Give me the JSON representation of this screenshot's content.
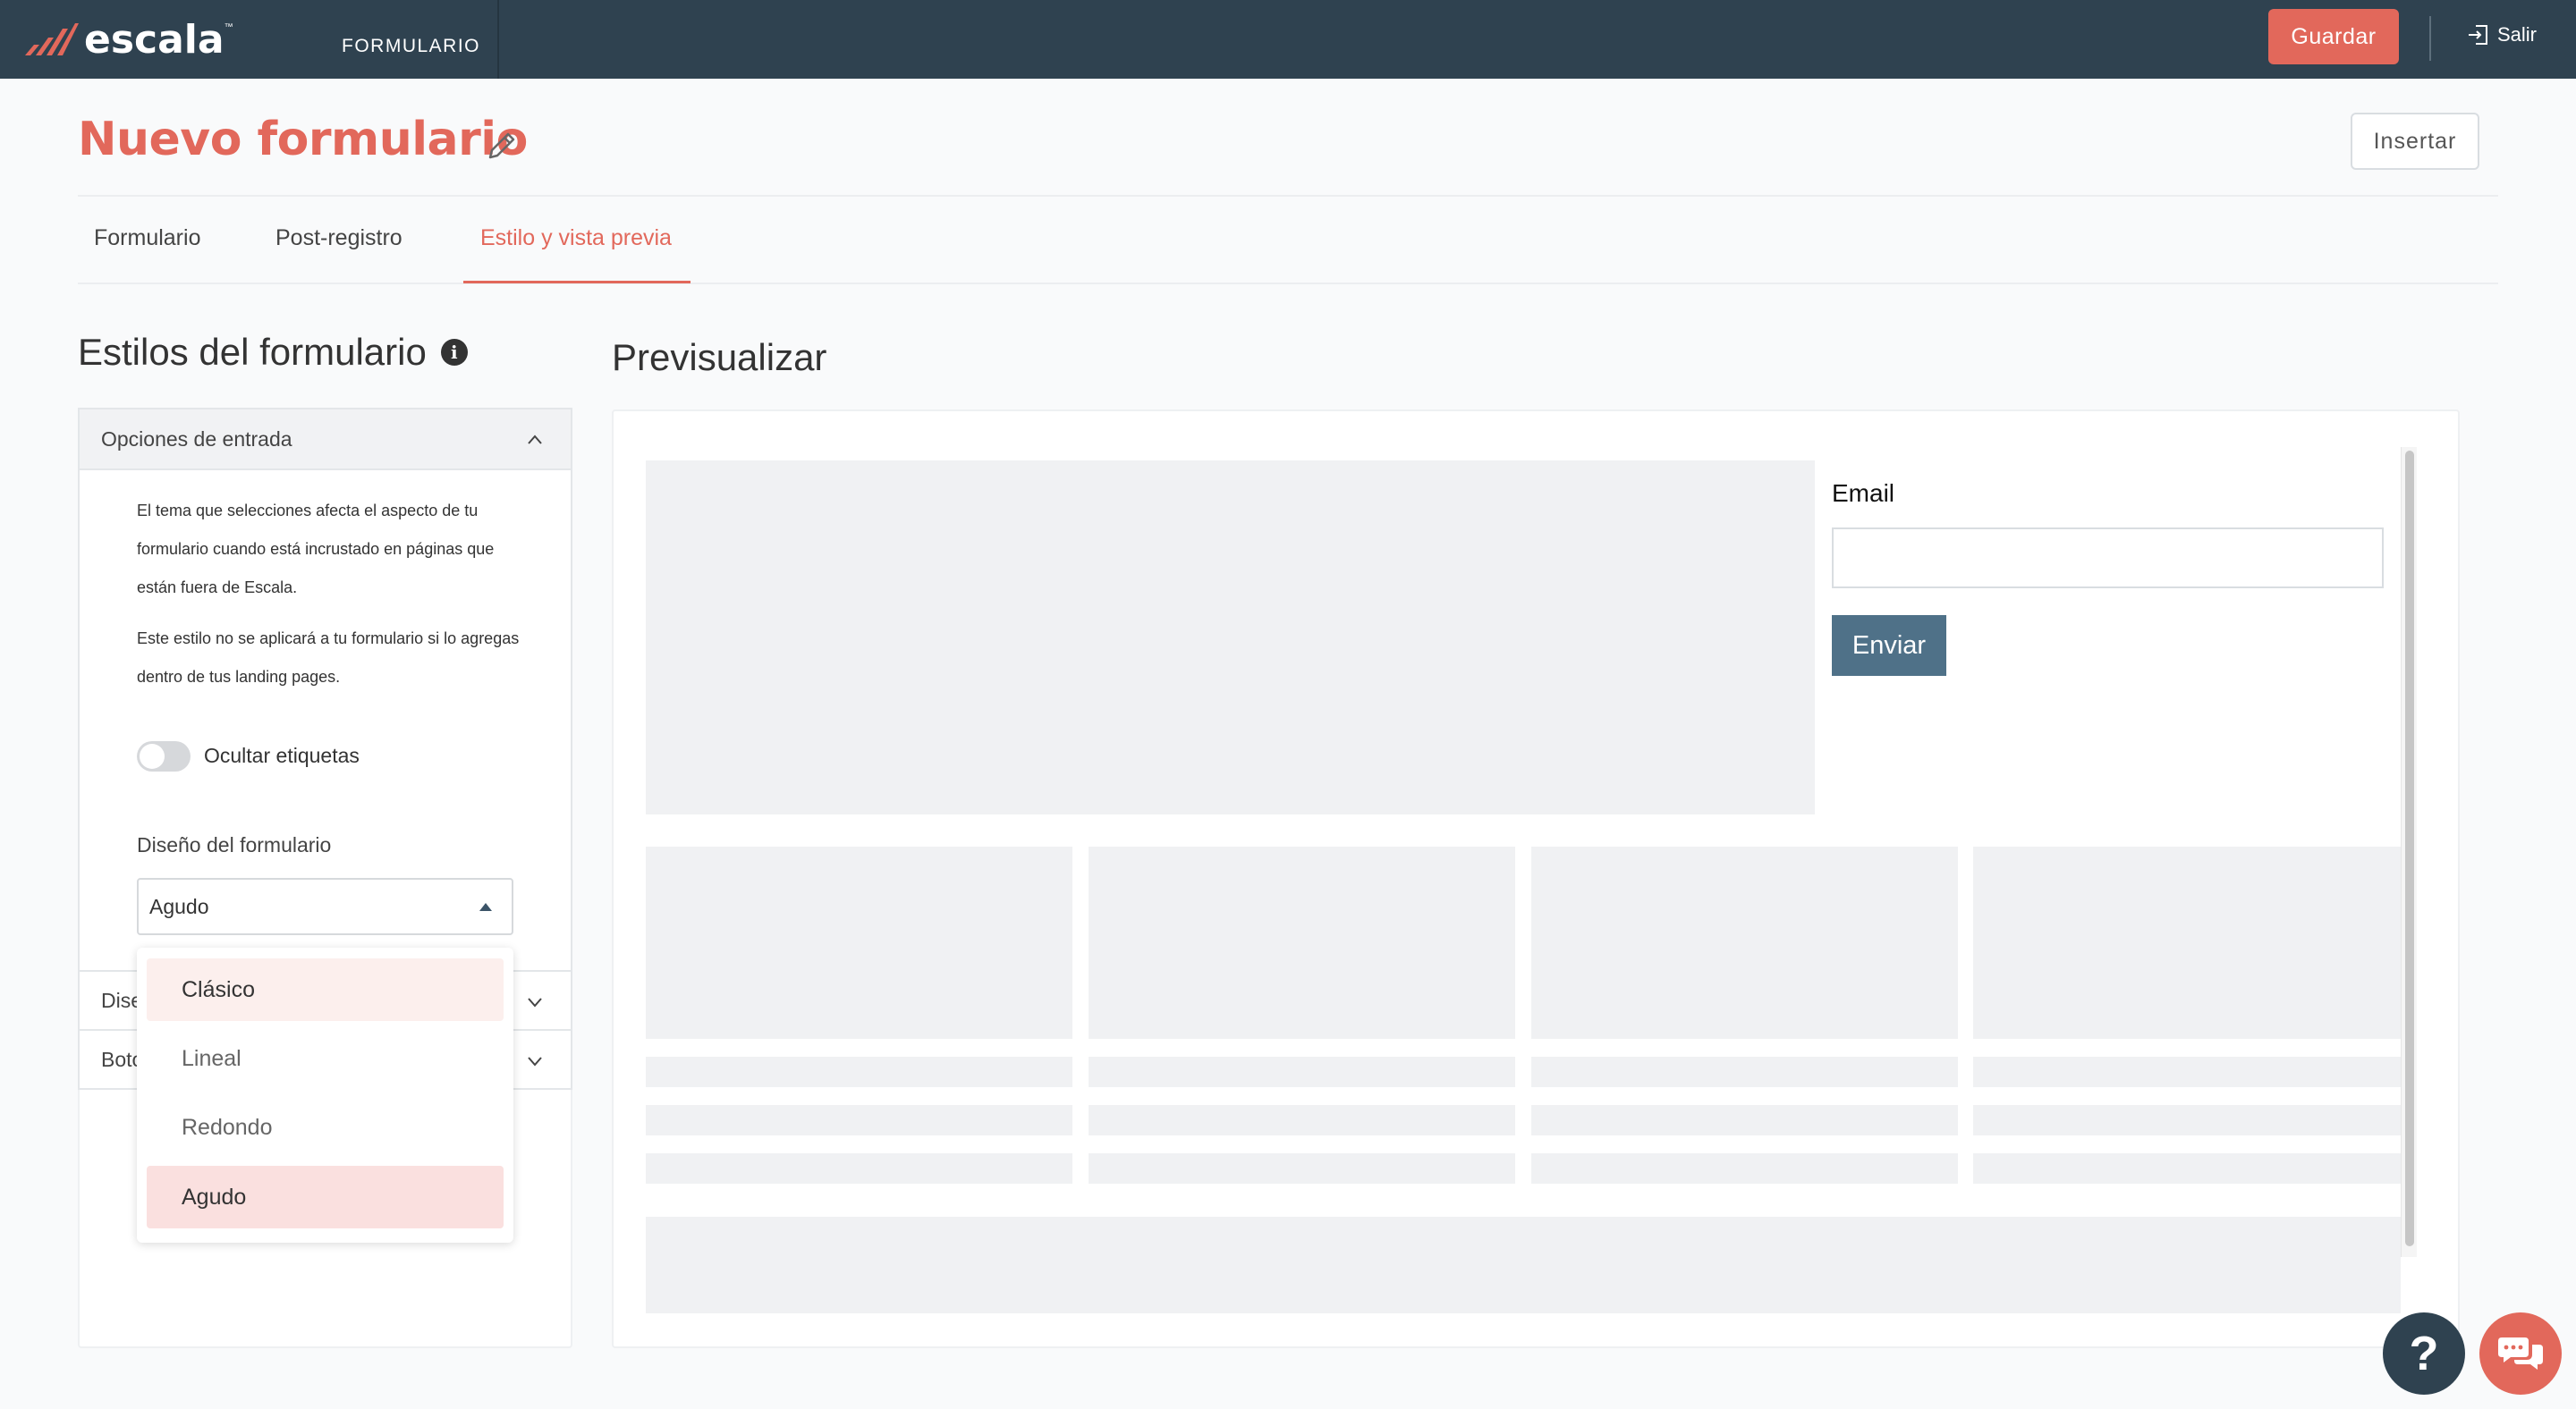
{
  "topbar": {
    "logo_text": "escala",
    "logo_tm": "™",
    "section": "FORMULARIO",
    "save_label": "Guardar",
    "exit_label": "Salir"
  },
  "header": {
    "title": "Nuevo formulario",
    "insert_label": "Insertar"
  },
  "tabs": [
    {
      "label": "Formulario",
      "active": false
    },
    {
      "label": "Post-registro",
      "active": false
    },
    {
      "label": "Estilo y vista previa",
      "active": true
    }
  ],
  "styles": {
    "heading": "Estilos del formulario",
    "info_glyph": "i",
    "input_options": {
      "title": "Opciones de entrada",
      "paragraph1": "El tema que selecciones afecta el aspecto de tu formulario cuando está incrustado en páginas que están fuera de Escala.",
      "paragraph2": "Este estilo no se aplicará a tu formulario si lo agregas dentro de tus landing pages.",
      "hide_labels_label": "Ocultar etiquetas",
      "hide_labels_on": false,
      "design_label": "Diseño del formulario",
      "design_value": "Agudo"
    },
    "collapsed_sections": [
      "Dise",
      "Boto"
    ]
  },
  "dropdown": {
    "options": [
      {
        "label": "Clásico",
        "state": "hover"
      },
      {
        "label": "Lineal",
        "state": "normal"
      },
      {
        "label": "Redondo",
        "state": "normal"
      },
      {
        "label": "Agudo",
        "state": "selected"
      }
    ]
  },
  "preview": {
    "heading": "Previsualizar",
    "email_label": "Email",
    "email_value": "",
    "send_label": "Enviar"
  },
  "floating": {
    "help_glyph": "?"
  },
  "colors": {
    "brand": "#e2685b",
    "topbar": "#2f4250",
    "send_button": "#4f7188"
  }
}
